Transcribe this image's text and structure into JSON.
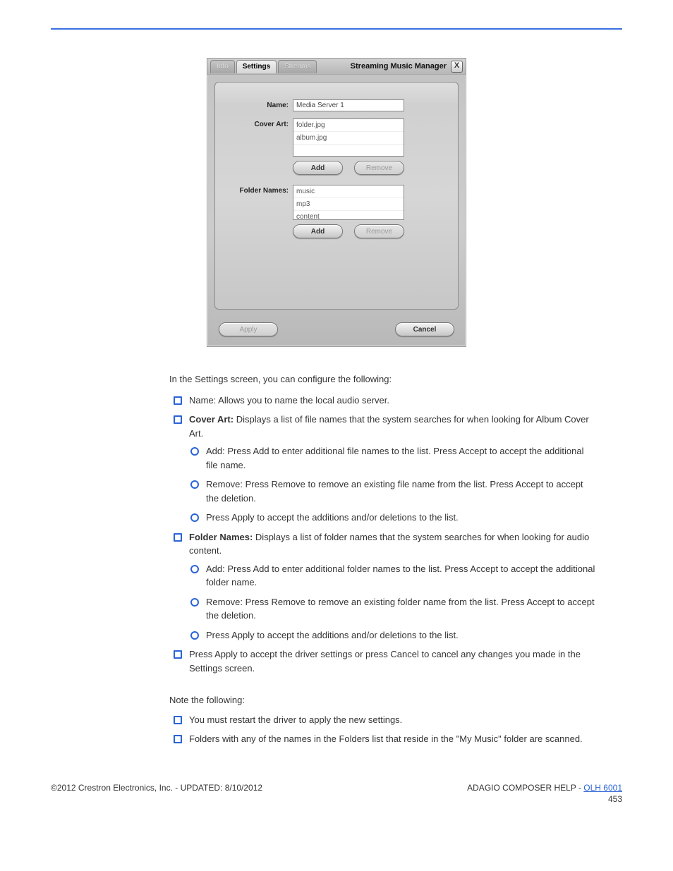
{
  "dialog": {
    "title": "Streaming Music Manager",
    "tabs": {
      "info": "Info",
      "settings": "Settings",
      "streams": "Streams"
    },
    "labels": {
      "name": "Name:",
      "cover_art": "Cover Art:",
      "folder_names": "Folder Names:"
    },
    "values": {
      "name": "Media Server 1"
    },
    "cover_art_list": [
      "folder.jpg",
      "album.jpg"
    ],
    "folder_names_list": [
      "music",
      "mp3",
      "content"
    ],
    "buttons": {
      "add": "Add",
      "remove": "Remove",
      "apply": "Apply",
      "cancel": "Cancel"
    },
    "close": "X"
  },
  "text": {
    "lead": "In the Settings screen, you can configure the following:",
    "b1": "Name: Allows you to name the local audio server.",
    "b2_prefix": "Cover Art: ",
    "b2_body": "Displays a list of file names that the system searches for when looking for Album Cover Art.",
    "b2_s1": "Add: Press Add to enter additional file names to the list. Press Accept to accept the additional file name.",
    "b2_s2": "Remove: Press Remove to remove an existing file name from the list. Press Accept to accept the deletion.",
    "b2_s3": "Press Apply to accept the additions and/or deletions to the list.",
    "b3_prefix": "Folder Names: ",
    "b3_body": "Displays a list of folder names that the system searches for when looking for audio content.",
    "b3_s1": "Add: Press Add to enter additional folder names to the list. Press Accept to accept the additional folder name.",
    "b3_s2": "Remove: Press Remove to remove an existing folder name from the list. Press Accept to accept the deletion.",
    "b3_s3": "Press Apply to accept the additions and/or deletions to the list.",
    "b4": "Press Apply to accept the driver settings or press Cancel to cancel any changes you made in the Settings screen.",
    "note_heading": "Note the following:",
    "n1": "You must restart the driver to apply the new settings.",
    "n2": "Folders with any of the names in the Folders list that reside in the \"My Music\" folder are scanned.",
    "footer_left": "©2012 Crestron Electronics, Inc. - UPDATED: 8/10/2012",
    "footer_right_label": "ADAGIO COMPOSER HELP - ",
    "footer_right_link": "OLH 6001",
    "pagenum": "453"
  }
}
